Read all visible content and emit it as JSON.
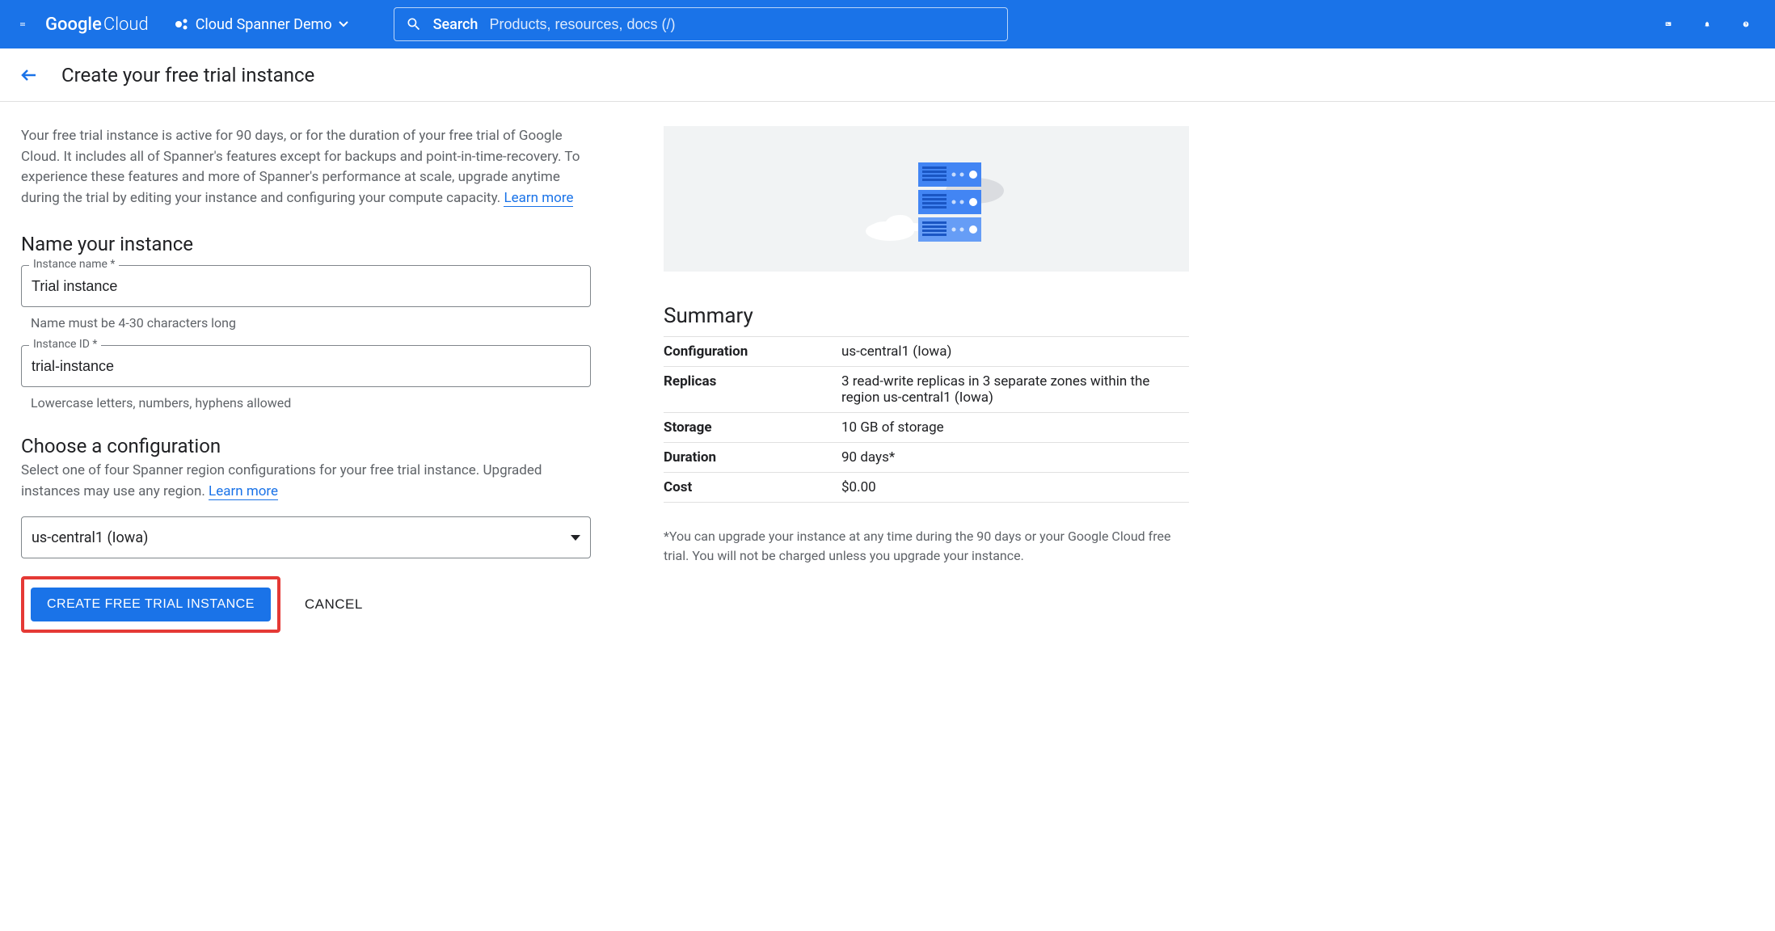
{
  "header": {
    "logo_google": "Google",
    "logo_cloud": "Cloud",
    "project_name": "Cloud Spanner Demo",
    "search_label": "Search",
    "search_placeholder": "Products, resources, docs (/)"
  },
  "subheader": {
    "title": "Create your free trial instance"
  },
  "intro": {
    "text": "Your free trial instance is active for 90 days, or for the duration of your free trial of Google Cloud. It includes all of Spanner's features except for backups and point-in-time-recovery. To experience these features and more of Spanner's performance at scale, upgrade anytime during the trial by editing your instance and configuring your compute capacity. ",
    "learn_more": "Learn more"
  },
  "section_name": {
    "heading": "Name your instance",
    "instance_name_label": "Instance name *",
    "instance_name_value": "Trial instance",
    "instance_name_helper": "Name must be 4-30 characters long",
    "instance_id_label": "Instance ID *",
    "instance_id_value": "trial-instance",
    "instance_id_helper": "Lowercase letters, numbers, hyphens allowed"
  },
  "section_config": {
    "heading": "Choose a configuration",
    "sub": "Select one of four Spanner region configurations for your free trial instance. Upgraded instances may use any region. ",
    "learn_more": "Learn more",
    "selected": "us-central1 (Iowa)"
  },
  "actions": {
    "create": "CREATE FREE TRIAL INSTANCE",
    "cancel": "CANCEL"
  },
  "summary": {
    "title": "Summary",
    "rows": [
      {
        "label": "Configuration",
        "value": "us-central1 (Iowa)"
      },
      {
        "label": "Replicas",
        "value": "3 read-write replicas in 3 separate zones within the region us-central1 (Iowa)"
      },
      {
        "label": "Storage",
        "value": "10 GB of storage"
      },
      {
        "label": "Duration",
        "value": "90 days*"
      },
      {
        "label": "Cost",
        "value": "$0.00"
      }
    ],
    "note": "*You can upgrade your instance at any time during the 90 days or your Google Cloud free trial. You will not be charged unless you upgrade your instance."
  }
}
